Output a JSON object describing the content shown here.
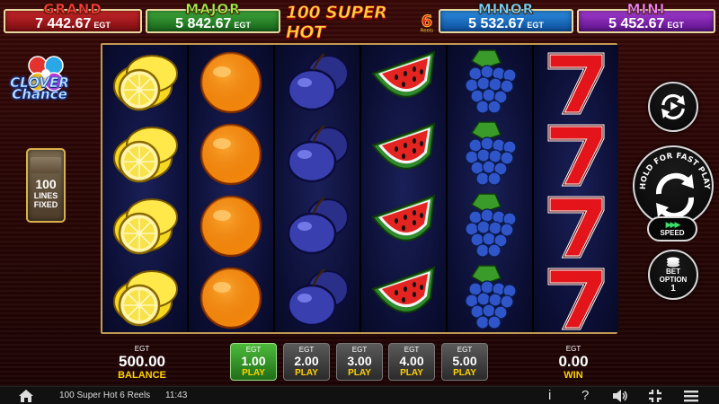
{
  "jackpots": {
    "grand": {
      "title": "GRAND",
      "value": "7 442.67",
      "currency": "EGT"
    },
    "major": {
      "title": "MAJOR",
      "value": "5 842.67",
      "currency": "EGT"
    },
    "minor": {
      "title": "MINOR",
      "value": "5 532.67",
      "currency": "EGT"
    },
    "mini": {
      "title": "MINI",
      "value": "5 452.67",
      "currency": "EGT"
    }
  },
  "logo": {
    "text": "100 SUPER HOT",
    "six": "6",
    "reels": "Reels"
  },
  "side_logo": {
    "line1": "CLOVER",
    "line2": "Chance"
  },
  "lines": {
    "value": "100",
    "label1": "LINES",
    "label2": "FIXED"
  },
  "reels": [
    [
      "lemon",
      "lemon",
      "lemon",
      "lemon"
    ],
    [
      "orange",
      "orange",
      "orange",
      "orange"
    ],
    [
      "plum",
      "plum",
      "plum",
      "plum"
    ],
    [
      "watermelon",
      "watermelon",
      "watermelon",
      "watermelon"
    ],
    [
      "grapes",
      "grapes",
      "grapes",
      "grapes"
    ],
    [
      "seven",
      "seven",
      "seven",
      "seven"
    ]
  ],
  "controls": {
    "spin_label": "HOLD FOR FAST PLAY",
    "speed_label": "SPEED",
    "bet_option_label1": "BET",
    "bet_option_label2": "OPTION",
    "bet_option_value": "1"
  },
  "balance": {
    "currency": "EGT",
    "value": "500.00",
    "label": "BALANCE"
  },
  "win": {
    "currency": "EGT",
    "value": "0.00",
    "label": "WIN"
  },
  "bets": [
    {
      "currency": "EGT",
      "value": "1.00",
      "label": "PLAY",
      "active": true
    },
    {
      "currency": "EGT",
      "value": "2.00",
      "label": "PLAY",
      "active": false
    },
    {
      "currency": "EGT",
      "value": "3.00",
      "label": "PLAY",
      "active": false
    },
    {
      "currency": "EGT",
      "value": "4.00",
      "label": "PLAY",
      "active": false
    },
    {
      "currency": "EGT",
      "value": "5.00",
      "label": "PLAY",
      "active": false
    }
  ],
  "status_bar": {
    "game_name": "100 Super Hot 6 Reels",
    "time": "11:43",
    "icons": [
      "home-icon",
      "info-icon",
      "help-icon",
      "sound-icon",
      "fullscreen-icon",
      "menu-icon"
    ]
  }
}
